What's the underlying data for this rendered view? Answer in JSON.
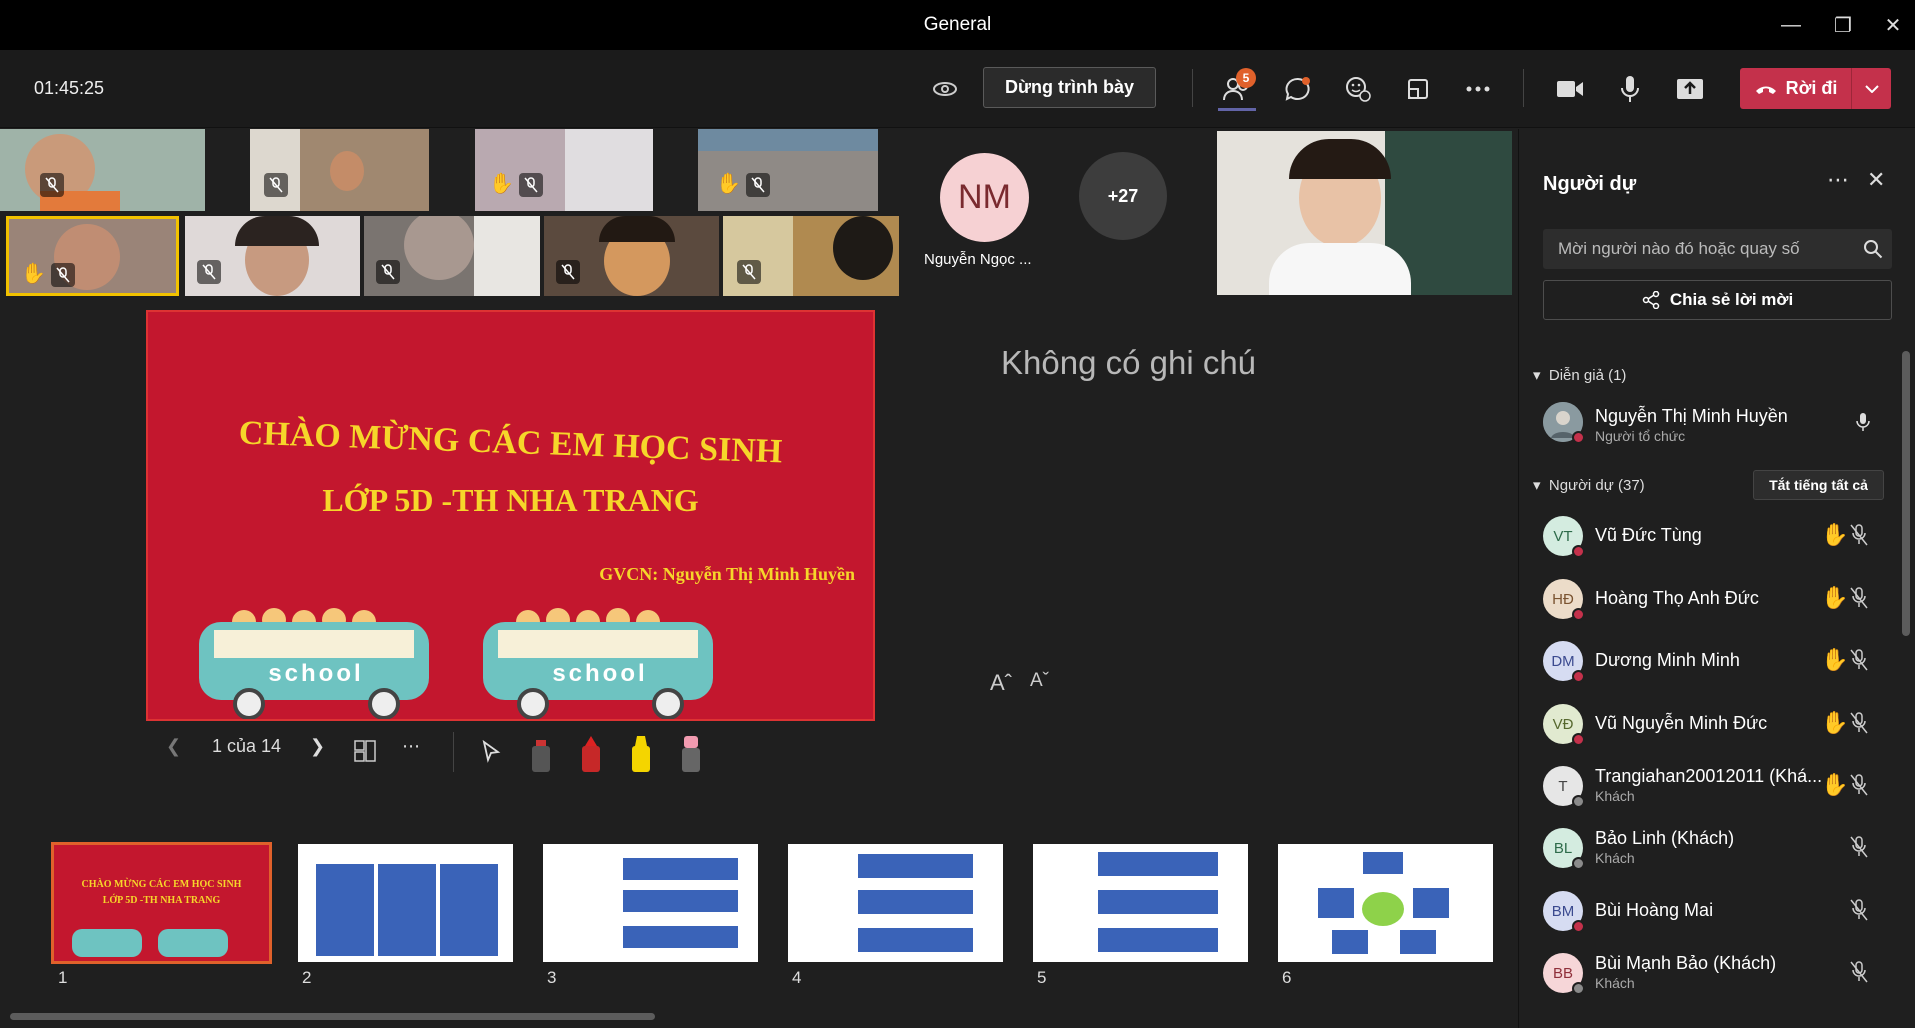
{
  "window": {
    "title": "General"
  },
  "toolbar": {
    "timer": "01:45:25",
    "stop_presenting": "Dừng trình bày",
    "participants_badge": "5",
    "leave": "Rời đi"
  },
  "gallery": {
    "avatar_initials": "NM",
    "avatar_name": "Nguyễn Ngọc ...",
    "more_count": "+27"
  },
  "slide": {
    "title_line1": "CHÀO MỪNG CÁC EM HỌC SINH",
    "title_line2": "LỚP 5D -TH NHA TRANG",
    "teacher": "GVCN: Nguyễn Thị Minh Huyền",
    "bus_label": "school",
    "notes": "Không có ghi chú",
    "font_increase": "Aˆ",
    "font_decrease": "Aˇ",
    "counter": "1 của 14"
  },
  "thumbnails": [
    {
      "num": "1"
    },
    {
      "num": "2"
    },
    {
      "num": "3"
    },
    {
      "num": "4"
    },
    {
      "num": "5"
    },
    {
      "num": "6"
    }
  ],
  "panel": {
    "title": "Người dự",
    "search_placeholder": "Mời người nào đó hoặc quay số",
    "share_invite": "Chia sẻ lời mời",
    "presenters_label": "Diễn giả (1)",
    "attendees_label": "Người dự (37)",
    "mute_all": "Tắt tiếng tất cả",
    "presenter": {
      "name": "Nguyễn Thị Minh Huyền",
      "role": "Người tổ chức"
    },
    "people": [
      {
        "initials": "VT",
        "name": "Vũ Đức Tùng",
        "sub": "",
        "hand": true
      },
      {
        "initials": "HĐ",
        "name": "Hoàng Thọ Anh Đức",
        "sub": "",
        "hand": true
      },
      {
        "initials": "DM",
        "name": "Dương Minh Minh",
        "sub": "",
        "hand": true
      },
      {
        "initials": "VĐ",
        "name": "Vũ Nguyễn Minh Đức",
        "sub": "",
        "hand": true
      },
      {
        "initials": "T",
        "name": "Trangiahan20012011 (Khá...",
        "sub": "Khách",
        "hand": true
      },
      {
        "initials": "BL",
        "name": "Bảo Linh (Khách)",
        "sub": "Khách",
        "hand": false
      },
      {
        "initials": "BM",
        "name": "Bùi Hoàng Mai",
        "sub": "",
        "hand": false
      },
      {
        "initials": "BB",
        "name": "Bùi Mạnh Bảo (Khách)",
        "sub": "Khách",
        "hand": false
      }
    ]
  },
  "colors": {
    "accent": "#6264a7",
    "leave": "#c4314b",
    "slide_bg": "#c3172e",
    "slide_text": "#f6d62a"
  }
}
